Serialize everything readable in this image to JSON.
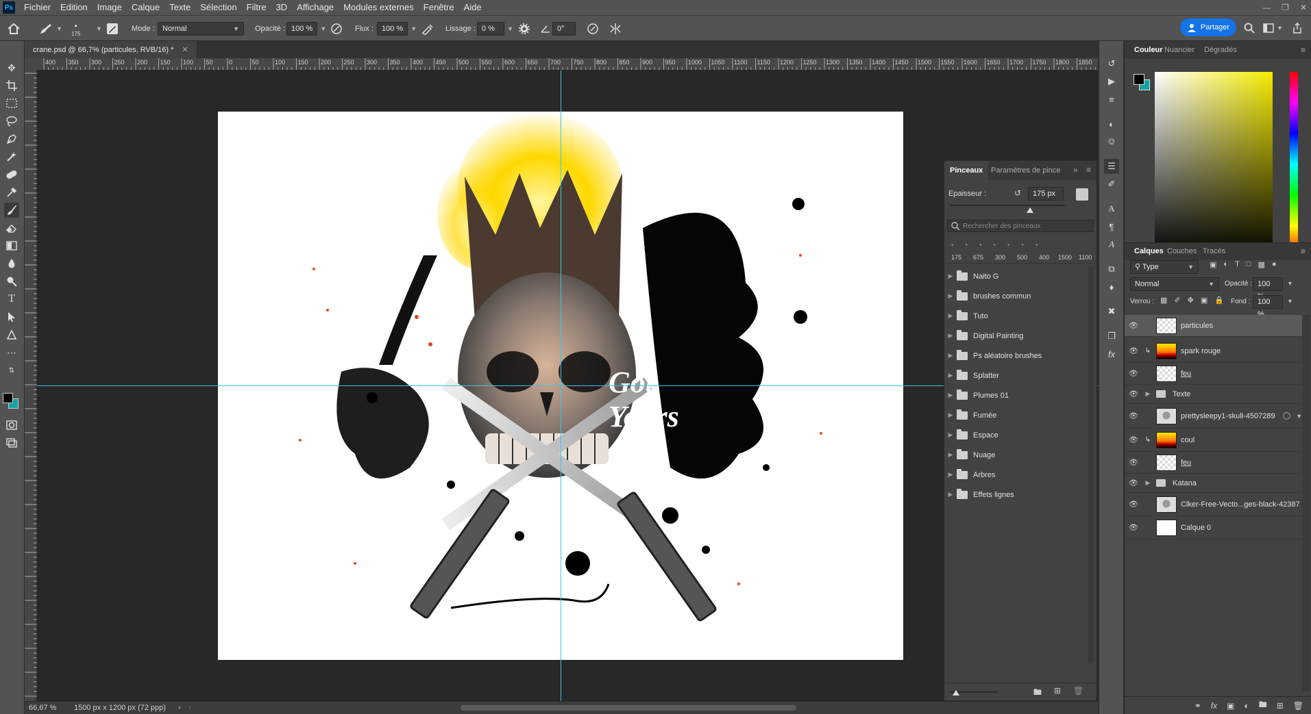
{
  "menubar": {
    "items": [
      "Fichier",
      "Edition",
      "Image",
      "Calque",
      "Texte",
      "Sélection",
      "Filtre",
      "3D",
      "Affichage",
      "Modules externes",
      "Fenêtre",
      "Aide"
    ]
  },
  "options": {
    "brush_size": "175",
    "mode_label": "Mode :",
    "mode_value": "Normal",
    "opacity_label": "Opacité :",
    "opacity_value": "100 %",
    "flow_label": "Flux :",
    "flow_value": "100 %",
    "smoothing_label": "Lissage :",
    "smoothing_value": "0 %",
    "angle_value": "0°",
    "share_label": "Partager"
  },
  "document": {
    "tab_title": "crane.psd @ 66,7% (particules, RVB/16) *",
    "zoom": "66,67 %",
    "doc_info": "1500 px x 1200 px (72 ppp)",
    "text_line1": "Got",
    "text_line2": "Yours"
  },
  "ruler": {
    "labels": [
      "400",
      "350",
      "300",
      "250",
      "200",
      "150",
      "100",
      "50",
      "0",
      "50",
      "100",
      "150",
      "200",
      "250",
      "300",
      "350",
      "400",
      "450",
      "500",
      "550",
      "600",
      "650",
      "700",
      "750",
      "800",
      "850",
      "900",
      "950",
      "1000",
      "1050",
      "1100",
      "1150",
      "1200",
      "1250",
      "1300",
      "1350",
      "1400",
      "1450",
      "1500",
      "1550",
      "1600",
      "1650",
      "1700",
      "1750",
      "1800",
      "1850"
    ]
  },
  "brushes": {
    "tab_brushes": "Pinceaux",
    "tab_settings": "Paramètres de pince",
    "size_label": "Epaisseur :",
    "size_value": "175 px",
    "search_placeholder": "Rechercher des pinceaux",
    "presets": [
      "175",
      "675",
      "300",
      "500",
      "400",
      "1500",
      "1100"
    ],
    "folders": [
      "Naito G",
      "brushes commun",
      "Tuto",
      "Digital Painting",
      "Ps aléatoire brushes",
      "Splatter",
      "Plumes 01",
      "Fumée",
      "Espace",
      "Nuage",
      "Arbres",
      "Effets lignes"
    ]
  },
  "color_panel": {
    "tabs": [
      "Couleur",
      "Nuancier",
      "Dégradés"
    ],
    "fg_color": "#000000",
    "bg_color": "#13a3a3",
    "hue_color": "#f5ec00"
  },
  "layers_panel": {
    "tabs": [
      "Calques",
      "Couches",
      "Tracés"
    ],
    "filter_value": "Type",
    "blend_mode": "Normal",
    "opacity_label": "Opacité :",
    "opacity_value": "100 %",
    "lock_label": "Verrou :",
    "fill_label": "Fond :",
    "fill_value": "100 %",
    "layers": [
      {
        "name": "particules",
        "thumb": "checker",
        "clipped": false,
        "group": false,
        "selected": true
      },
      {
        "name": "spark rouge",
        "thumb": "gradient",
        "clipped": true,
        "group": false,
        "selected": false
      },
      {
        "name": "feu",
        "thumb": "checker",
        "clipped": false,
        "group": false,
        "selected": false
      },
      {
        "name": "Texte",
        "thumb": "folder",
        "clipped": false,
        "group": true,
        "selected": false
      },
      {
        "name": "prettysleepy1-skull-4507289",
        "thumb": "skull",
        "clipped": false,
        "group": false,
        "selected": false
      },
      {
        "name": "coul",
        "thumb": "gradient",
        "clipped": true,
        "group": false,
        "selected": false
      },
      {
        "name": "feu",
        "thumb": "checker",
        "clipped": false,
        "group": false,
        "selected": false
      },
      {
        "name": "Katana",
        "thumb": "folder",
        "clipped": false,
        "group": true,
        "selected": false
      },
      {
        "name": "Clker-Free-Vecto...ges-black-42387",
        "thumb": "skull",
        "clipped": false,
        "group": false,
        "selected": false
      },
      {
        "name": "Calque 0",
        "thumb": "white",
        "clipped": false,
        "group": false,
        "selected": false
      }
    ]
  }
}
